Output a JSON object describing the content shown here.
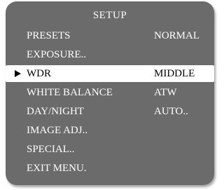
{
  "menu": {
    "title": "SETUP",
    "items": [
      {
        "label": "PRESETS",
        "value": "NORMAL",
        "selected": false
      },
      {
        "label": "EXPOSURE..",
        "value": "",
        "selected": false
      },
      {
        "label": "WDR",
        "value": "MIDDLE",
        "selected": true
      },
      {
        "label": "WHITE BALANCE",
        "value": "ATW",
        "selected": false
      },
      {
        "label": "DAY/NIGHT",
        "value": "AUTO..",
        "selected": false
      },
      {
        "label": "IMAGE ADJ..",
        "value": "",
        "selected": false
      },
      {
        "label": "SPECIAL..",
        "value": "",
        "selected": false
      },
      {
        "label": "EXIT MENU.",
        "value": "",
        "selected": false
      }
    ]
  },
  "colors": {
    "panel_background": "#6b6b6b",
    "text": "#ffffff",
    "selected_row_background": "#ffffff",
    "selected_row_text": "#000000"
  },
  "icons": {
    "cursor": "right-triangle-pointer-icon"
  }
}
